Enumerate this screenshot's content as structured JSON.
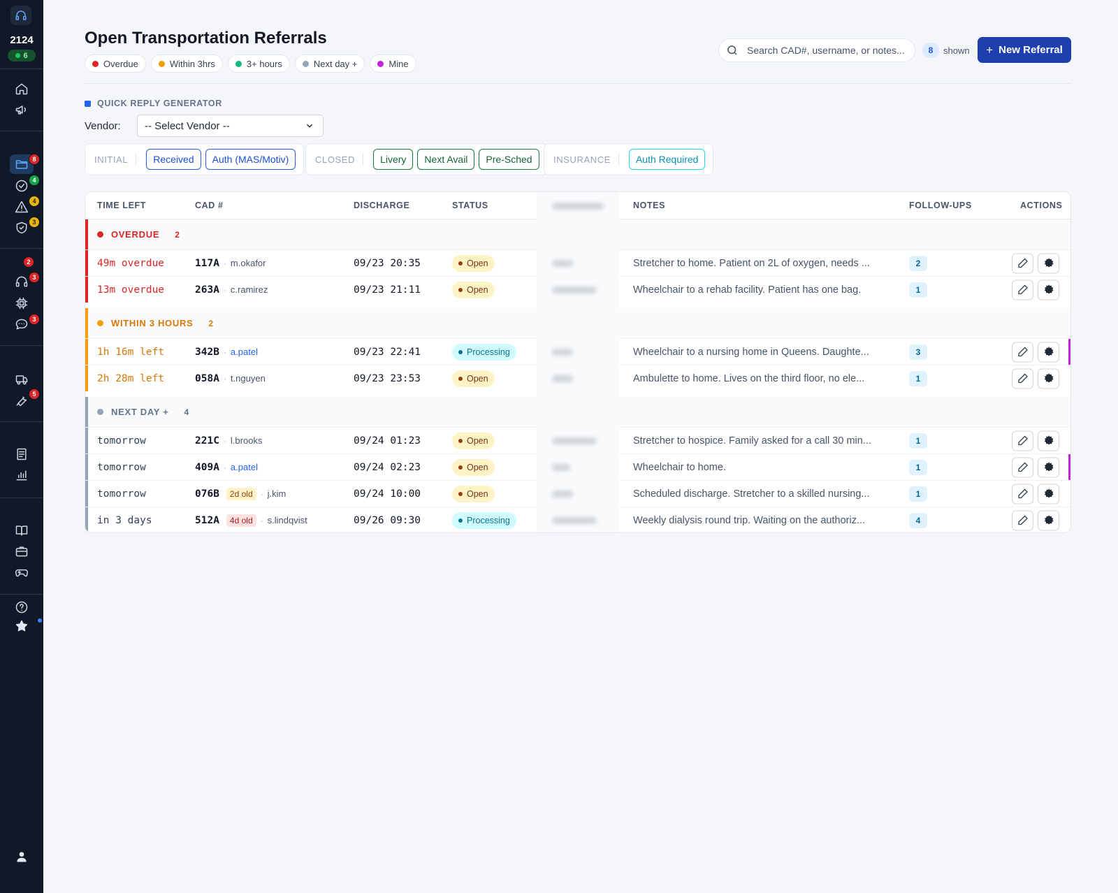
{
  "sidebar": {
    "count": "2124",
    "online": "6",
    "badges": {
      "folder": "8",
      "check": "4",
      "alert": "4",
      "shield": "3",
      "top_red": "2",
      "headset": "3",
      "chat": "3",
      "tools": "5"
    }
  },
  "header": {
    "title": "Open Transportation Referrals",
    "legend": [
      {
        "label": "Overdue",
        "color": "#dc2626"
      },
      {
        "label": "Within 3hrs",
        "color": "#f59e0b"
      },
      {
        "label": "3+ hours",
        "color": "#10b981"
      },
      {
        "label": "Next day +",
        "color": "#94a3b8"
      },
      {
        "label": "Mine",
        "color": "#c026d3"
      }
    ],
    "search_placeholder": "Search CAD#, username, or notes...",
    "shown_count": "8",
    "shown_label": "shown",
    "new_button": "New Referral"
  },
  "quick_reply": {
    "label": "QUICK REPLY GENERATOR",
    "vendor_label": "Vendor:",
    "vendor_value": "-- Select Vendor --",
    "groups": [
      {
        "label": "INITIAL",
        "chips": [
          "Received",
          "Auth (MAS/Motiv)"
        ]
      },
      {
        "label": "CLOSED",
        "chips": [
          "Livery",
          "Next Avail",
          "Pre-Sched"
        ]
      },
      {
        "label": "INSURANCE",
        "chips": [
          "Auth Required"
        ]
      }
    ]
  },
  "table": {
    "headers": {
      "time_left": "TIME LEFT",
      "cad": "CAD #",
      "discharge": "DISCHARGE",
      "status": "STATUS",
      "notes": "NOTES",
      "followups": "FOLLOW-UPS",
      "actions": "ACTIONS"
    },
    "groups": [
      {
        "title": "OVERDUE",
        "count": "2"
      },
      {
        "title": "WITHIN 3 HOURS",
        "count": "2"
      },
      {
        "title": "NEXT DAY +",
        "count": "4"
      }
    ],
    "rows": [
      {
        "time_left": "49m overdue",
        "cad": "117A",
        "user": "m.okafor",
        "age": "",
        "discharge": "09/23 20:35",
        "status": "Open",
        "notes": "Stretcher to home. Patient on 2L of oxygen, needs ...",
        "followups": "2"
      },
      {
        "time_left": "13m overdue",
        "cad": "263A",
        "user": "c.ramirez",
        "age": "",
        "discharge": "09/23 21:11",
        "status": "Open",
        "notes": "Wheelchair to a rehab facility. Patient has one bag.",
        "followups": "1"
      },
      {
        "time_left": "1h 16m left",
        "cad": "342B",
        "user": "a.patel",
        "age": "",
        "discharge": "09/23 22:41",
        "status": "Processing",
        "notes": "Wheelchair to a nursing home in Queens. Daughte...",
        "followups": "3"
      },
      {
        "time_left": "2h 28m left",
        "cad": "058A",
        "user": "t.nguyen",
        "age": "",
        "discharge": "09/23 23:53",
        "status": "Open",
        "notes": "Ambulette to home. Lives on the third floor, no ele...",
        "followups": "1"
      },
      {
        "time_left": "tomorrow",
        "cad": "221C",
        "user": "l.brooks",
        "age": "",
        "discharge": "09/24 01:23",
        "status": "Open",
        "notes": "Stretcher to hospice. Family asked for a call 30 min...",
        "followups": "1"
      },
      {
        "time_left": "tomorrow",
        "cad": "409A",
        "user": "a.patel",
        "age": "",
        "discharge": "09/24 02:23",
        "status": "Open",
        "notes": "Wheelchair to home.",
        "followups": "1"
      },
      {
        "time_left": "tomorrow",
        "cad": "076B",
        "user": "j.kim",
        "age": "2d old",
        "discharge": "09/24 10:00",
        "status": "Open",
        "notes": "Scheduled discharge. Stretcher to a skilled nursing...",
        "followups": "1"
      },
      {
        "time_left": "in 3 days",
        "cad": "512A",
        "user": "s.lindqvist",
        "age": "4d old",
        "discharge": "09/26 09:30",
        "status": "Processing",
        "notes": "Weekly dialysis round trip. Waiting on the authoriz...",
        "followups": "4"
      }
    ]
  }
}
